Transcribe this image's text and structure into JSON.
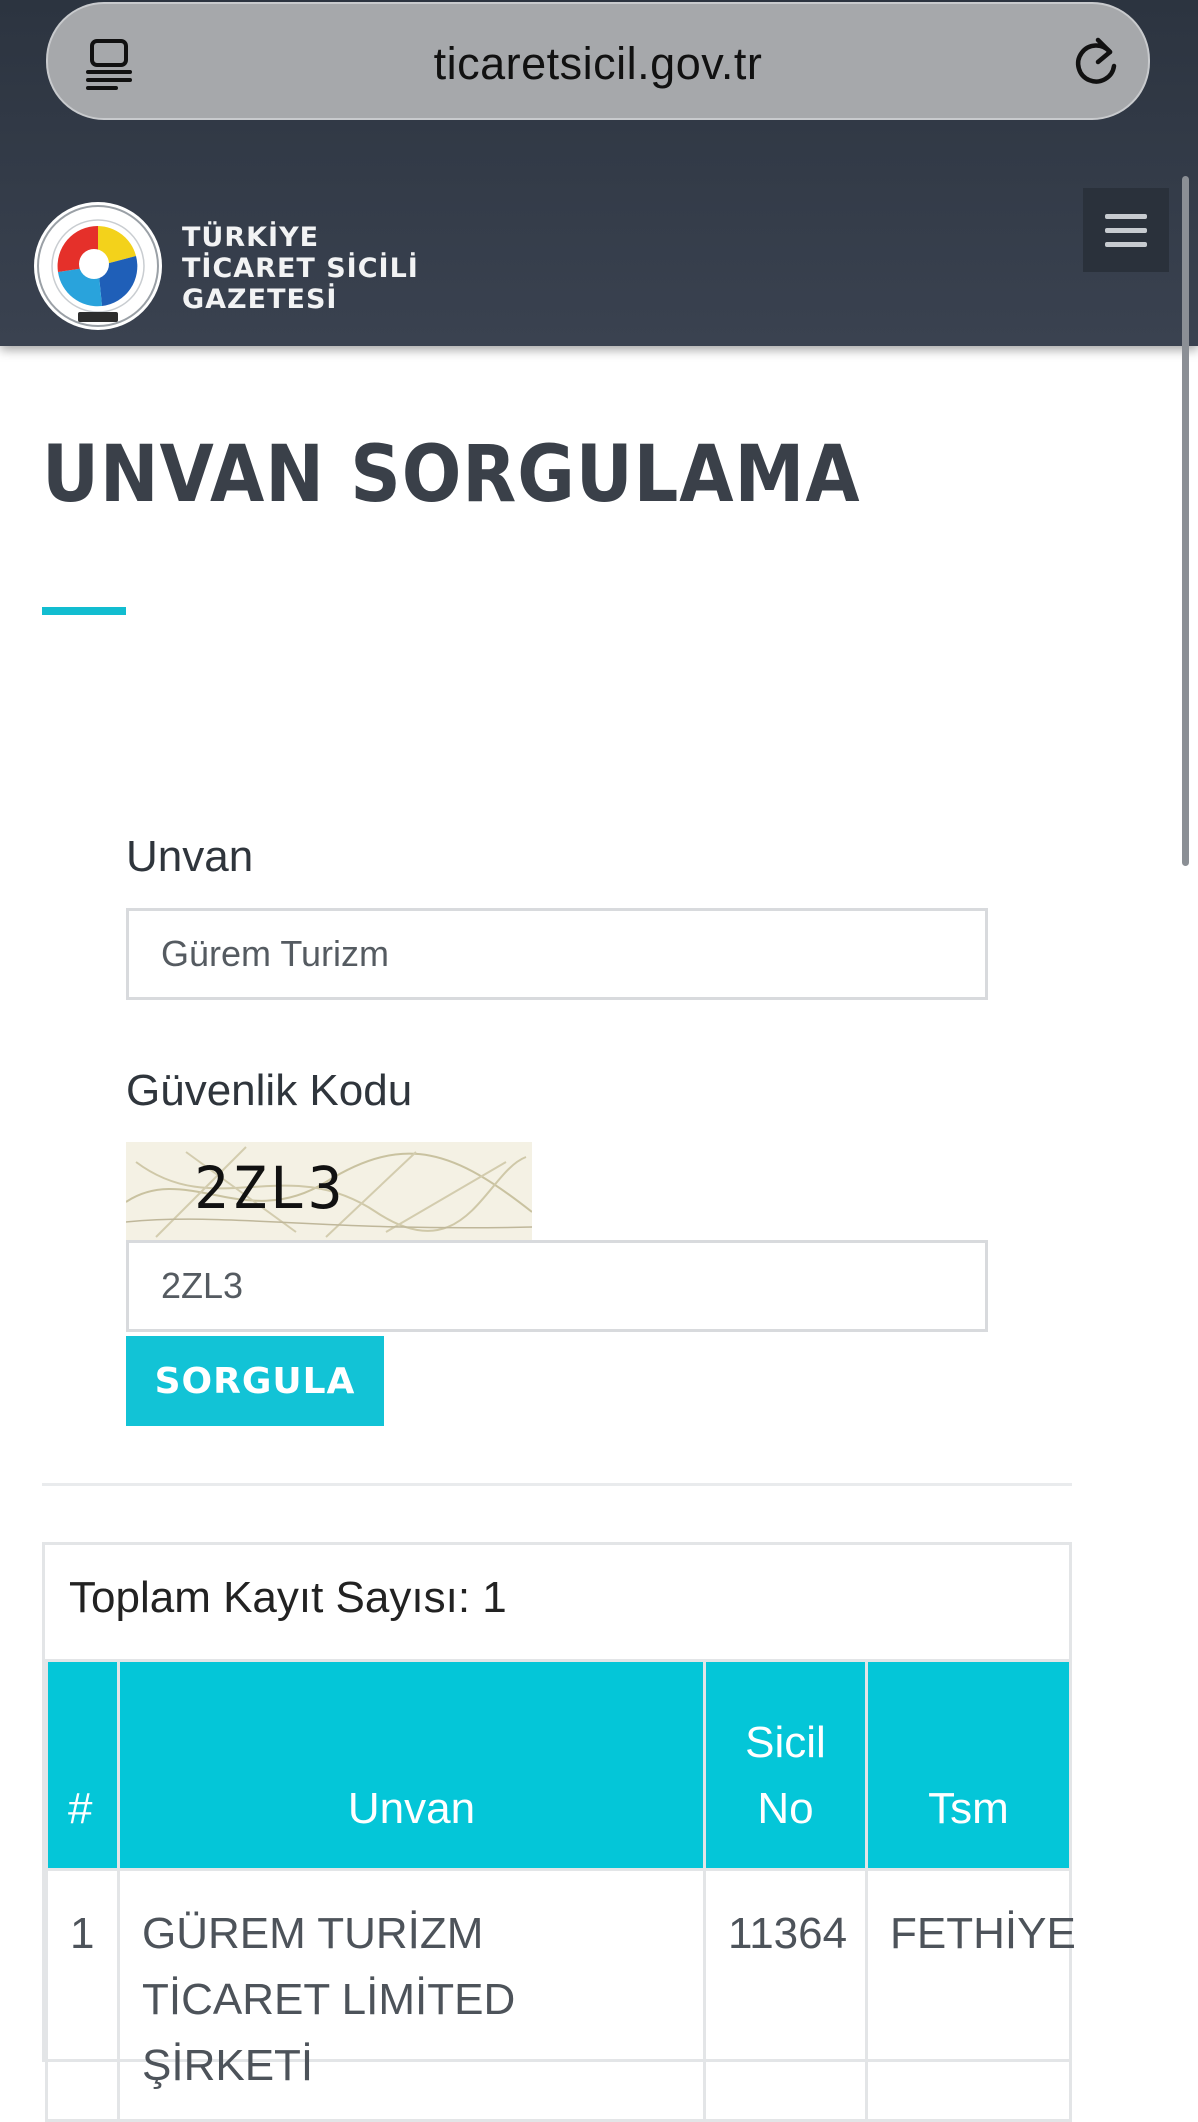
{
  "browser": {
    "url": "ticaretsicil.gov.tr"
  },
  "header": {
    "brand_line1": "TÜRKİYE",
    "brand_line2": "TİCARET SİCİLİ",
    "brand_line3": "GAZETESİ"
  },
  "page": {
    "title": "UNVAN SORGULAMA"
  },
  "form": {
    "unvan_label": "Unvan",
    "unvan_value": "Gürem Turizm",
    "guvenlik_label": "Güvenlik Kodu",
    "captcha_text": "2ZL3",
    "guvenlik_value": "2ZL3",
    "submit_label": "SORGULA"
  },
  "results": {
    "total": "Toplam Kayıt Sayısı: 1",
    "columns": [
      "#",
      "Unvan",
      "Sicil No",
      "Tsm"
    ],
    "rows": [
      {
        "index": "1",
        "unvan": "GÜREM TURİZM TİCARET LİMİTED ŞİRKETİ",
        "sicil_no": "11364",
        "tsm": "FETHİYE"
      }
    ]
  },
  "colors": {
    "header_bg": "#353d49",
    "accent": "#04c6d8",
    "title_text": "#3a4049"
  }
}
